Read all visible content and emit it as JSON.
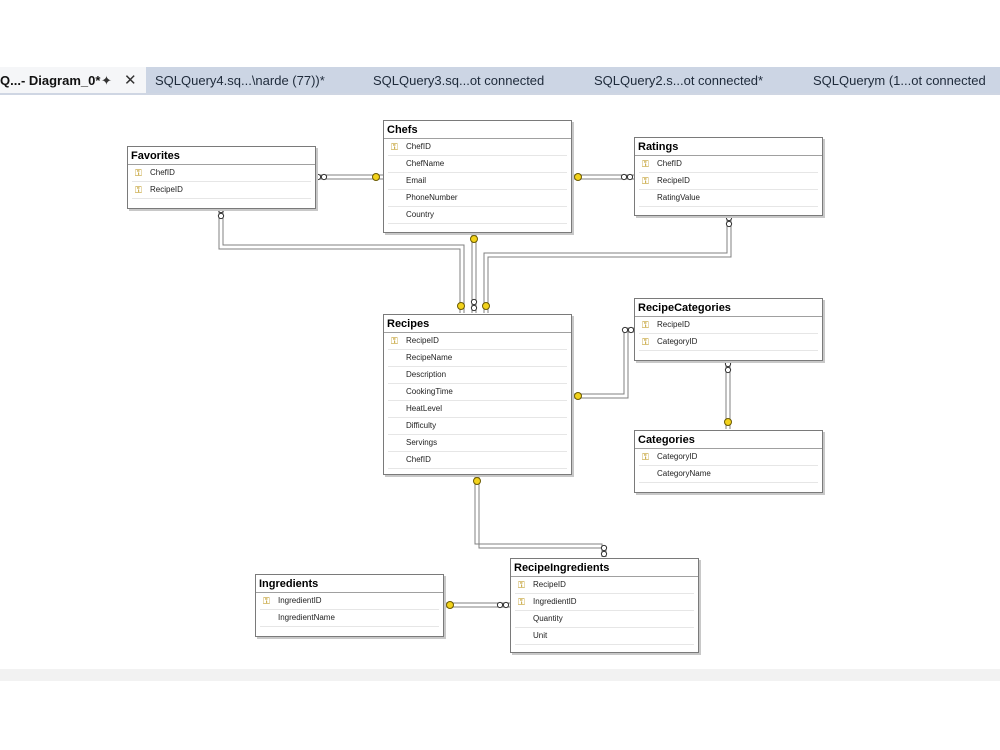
{
  "tabs": [
    {
      "label": "Q...- Diagram_0*",
      "active": true
    },
    {
      "label": "SQLQuery4.sq...\\narde (77))*"
    },
    {
      "label": "SQLQuery3.sq...ot connected"
    },
    {
      "label": "SQLQuery2.s...ot connected*"
    },
    {
      "label": "SQLQuerym (1...ot connected"
    }
  ],
  "icons": {
    "pin": "pin-icon",
    "close": "close-icon",
    "key": "primary-key-icon"
  },
  "colors": {
    "tabbar": "#ccd5e4",
    "connector": "#7f7f7f",
    "key_endpoint": "#f2d21b"
  },
  "tables": {
    "chefs": {
      "name": "Chefs",
      "columns": [
        "ChefID",
        "ChefName",
        "Email",
        "PhoneNumber",
        "Country"
      ],
      "keys": [
        0
      ]
    },
    "favorites": {
      "name": "Favorites",
      "columns": [
        "ChefID",
        "RecipeID"
      ],
      "keys": [
        0,
        1
      ]
    },
    "ratings": {
      "name": "Ratings",
      "columns": [
        "ChefID",
        "RecipeID",
        "RatingValue"
      ],
      "keys": [
        0,
        1
      ]
    },
    "recipes": {
      "name": "Recipes",
      "columns": [
        "RecipeID",
        "RecipeName",
        "Description",
        "CookingTime",
        "HeatLevel",
        "Difficulty",
        "Servings",
        "ChefID"
      ],
      "keys": [
        0
      ]
    },
    "recipecategories": {
      "name": "RecipeCategories",
      "columns": [
        "RecipeID",
        "CategoryID"
      ],
      "keys": [
        0,
        1
      ]
    },
    "categories": {
      "name": "Categories",
      "columns": [
        "CategoryID",
        "CategoryName"
      ],
      "keys": [
        0
      ]
    },
    "ingredients": {
      "name": "Ingredients",
      "columns": [
        "IngredientID",
        "IngredientName"
      ],
      "keys": [
        0
      ]
    },
    "recipeingredients": {
      "name": "RecipeIngredients",
      "columns": [
        "RecipeID",
        "IngredientID",
        "Quantity",
        "Unit"
      ],
      "keys": [
        0,
        1
      ]
    }
  }
}
